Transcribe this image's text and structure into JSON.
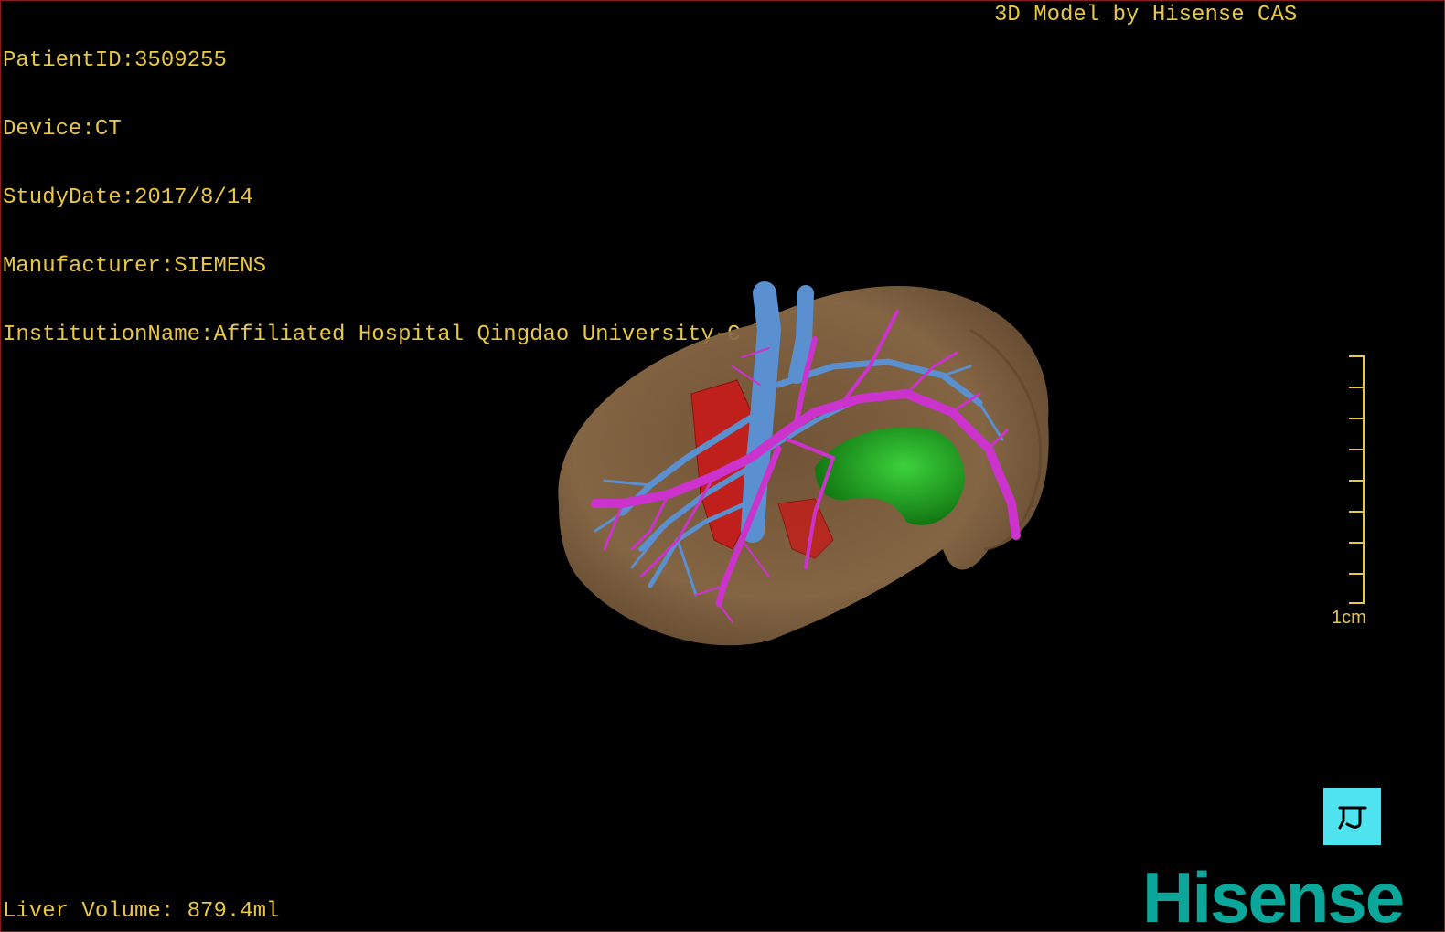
{
  "dicom": {
    "patient_id": "PatientID:3509255",
    "device": "Device:CT",
    "study_date": "StudyDate:2017/8/14",
    "manufacturer": "Manufacturer:SIEMENS",
    "institution": "InstitutionName:Affiliated Hospital Qingdao University-C"
  },
  "header": {
    "model_by": "3D Model by Hisense CAS"
  },
  "footer": {
    "liver_volume": "Liver Volume: 879.4ml"
  },
  "scale": {
    "label": "1cm"
  },
  "brand": {
    "logo_text": "Hisense"
  },
  "colors": {
    "text": "#e8c646",
    "liver": "#8a6a46",
    "portal_vein": "#5a8fd0",
    "hepatic_vein": "#cc33cc",
    "artery": "#c0201c",
    "gallbladder": "#22a022",
    "orient_button": "#4fe3ef",
    "logo": "#0aa79a",
    "border": "#8b1a1a"
  },
  "icons": {
    "orientation": "head-orientation-icon"
  }
}
